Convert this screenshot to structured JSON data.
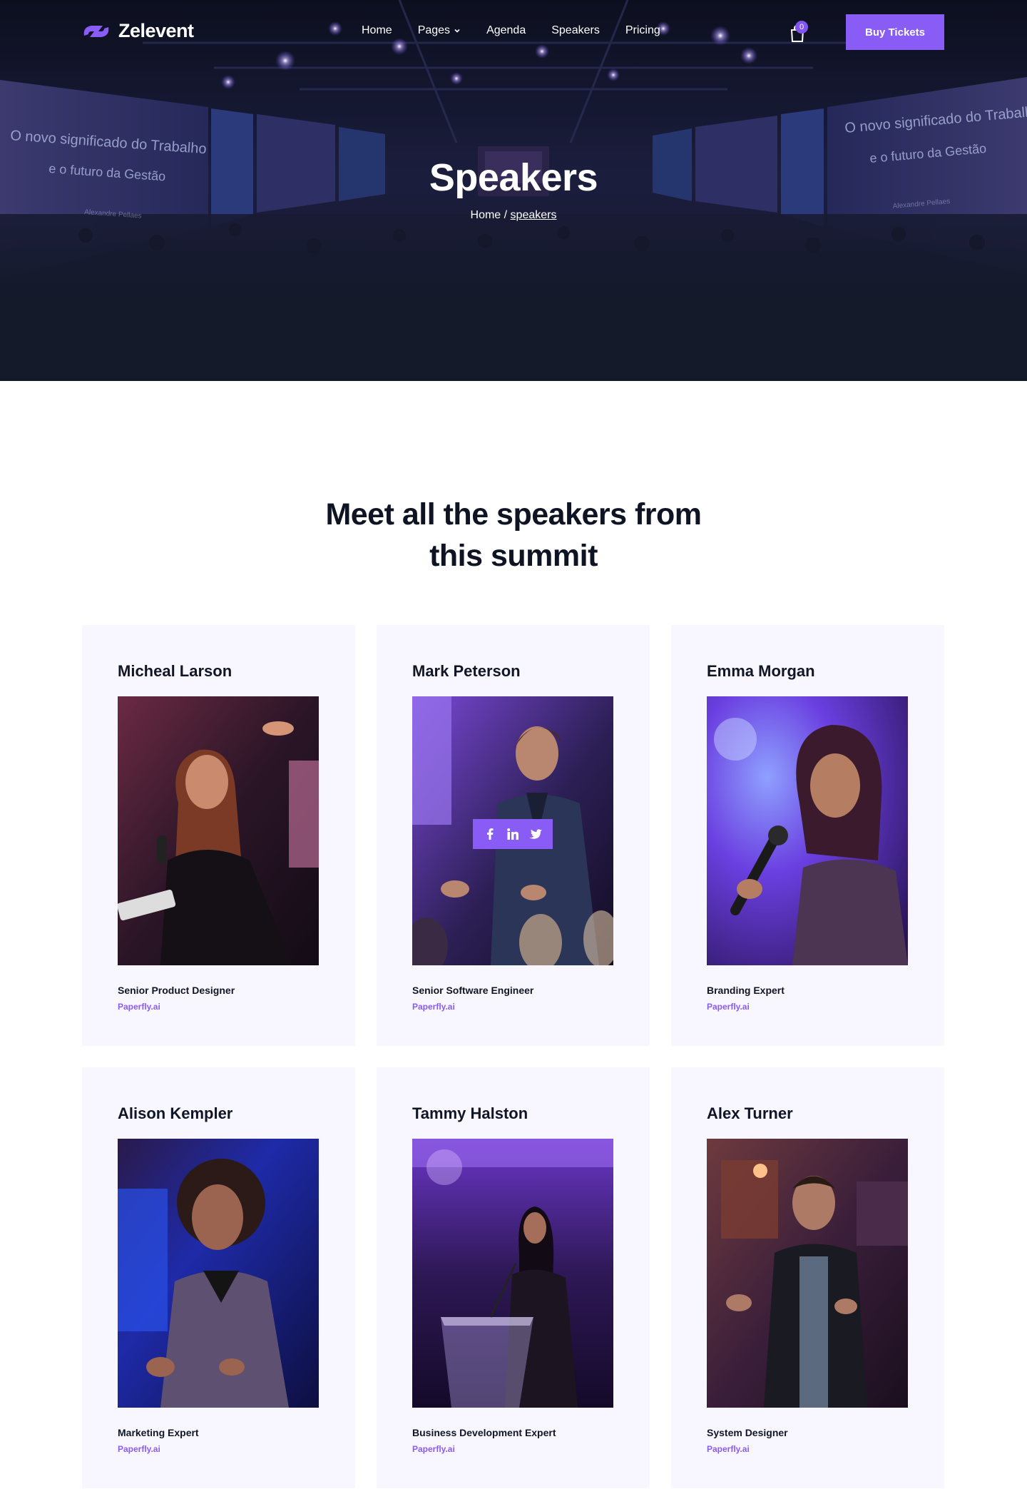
{
  "brand": {
    "name": "Zelevent",
    "accent": "#8a5cf6"
  },
  "nav": {
    "items": [
      {
        "label": "Home",
        "has_dropdown": false
      },
      {
        "label": "Pages",
        "has_dropdown": true
      },
      {
        "label": "Agenda",
        "has_dropdown": false
      },
      {
        "label": "Speakers",
        "has_dropdown": false
      },
      {
        "label": "Pricing",
        "has_dropdown": false
      }
    ],
    "cart_count": "0",
    "cta_label": "Buy Tickets"
  },
  "hero": {
    "title": "Speakers",
    "breadcrumb": {
      "home": "Home",
      "separator": " / ",
      "current": "speakers"
    },
    "screen_text": {
      "line1": "O novo significado do Trabalho",
      "line2": "e o futuro da Gestão",
      "signature": "Alexandre Pellaes"
    }
  },
  "section": {
    "title_line1": "Meet all the speakers from",
    "title_line2": "this summit"
  },
  "speakers": [
    {
      "name": "Micheal Larson",
      "role": "Senior Product Designer",
      "company": "Paperfly.ai"
    },
    {
      "name": "Mark Peterson",
      "role": "Senior Software Engineer",
      "company": "Paperfly.ai"
    },
    {
      "name": "Emma Morgan",
      "role": "Branding Expert",
      "company": "Paperfly.ai"
    },
    {
      "name": "Alison Kempler",
      "role": "Marketing Expert",
      "company": "Paperfly.ai"
    },
    {
      "name": "Tammy Halston",
      "role": "Business Development Expert",
      "company": "Paperfly.ai"
    },
    {
      "name": "Alex Turner",
      "role": "System Designer",
      "company": "Paperfly.ai"
    }
  ],
  "social_icons": [
    "facebook-icon",
    "linkedin-icon",
    "twitter-icon"
  ]
}
